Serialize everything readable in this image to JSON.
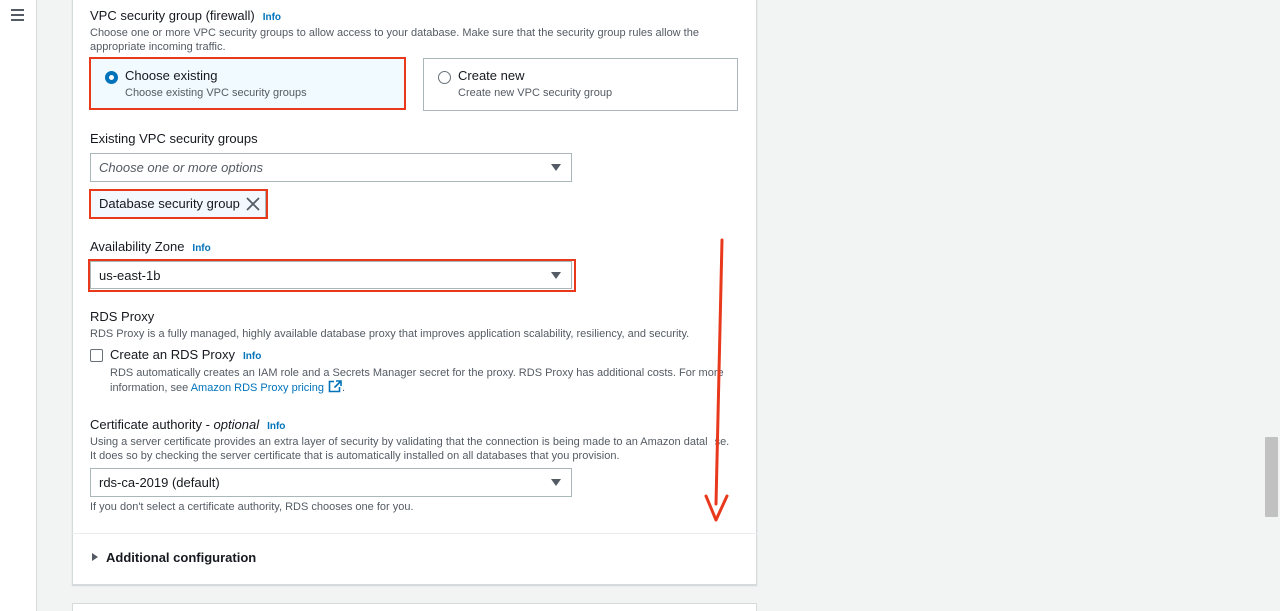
{
  "security_group": {
    "heading": "VPC security group (firewall)",
    "info_label": "Info",
    "description_line1": "Choose one or more VPC security groups to allow access to your database. Make sure that the security group rules allow the",
    "description_line2": "appropriate incoming traffic.",
    "options": [
      {
        "title": "Choose existing",
        "description": "Choose existing VPC security groups",
        "selected": true
      },
      {
        "title": "Create new",
        "description": "Create new VPC security group",
        "selected": false
      }
    ]
  },
  "existing_groups": {
    "label": "Existing VPC security groups",
    "placeholder": "Choose one or more options",
    "selected_token": "Database security group"
  },
  "availability_zone": {
    "label": "Availability Zone",
    "info_label": "Info",
    "value": "us-east-1b"
  },
  "rds_proxy": {
    "heading": "RDS Proxy",
    "description": "RDS Proxy is a fully managed, highly available database proxy that improves application scalability, resiliency, and security.",
    "checkbox_label": "Create an RDS Proxy",
    "info_label": "Info",
    "checked": false,
    "detail_line1": "RDS automatically creates an IAM role and a Secrets Manager secret for the proxy. RDS Proxy has additional costs. For more",
    "detail_prefix": "information, see ",
    "pricing_link": "Amazon RDS Proxy pricing",
    "detail_suffix": "."
  },
  "certificate_authority": {
    "label": "Certificate authority - ",
    "label_optional": "optional",
    "info_label": "Info",
    "description_line1": "Using a server certificate provides an extra layer of security by validating that the connection is being made to an Amazon datal",
    "description_line1_tail": "se.",
    "description_line2": "It does so by checking the server certificate that is automatically installed on all databases that you provision.",
    "value": "rds-ca-2019 (default)",
    "hint": "If you don't select a certificate authority, RDS chooses one for you."
  },
  "additional_configuration": {
    "label": "Additional configuration",
    "expanded": false
  },
  "colors": {
    "highlight": "#e8391d",
    "accent": "#0073bb"
  },
  "icons": [
    "menu-icon",
    "close-icon",
    "caret-down-icon",
    "external-link-icon",
    "arrow-down-annotation"
  ]
}
